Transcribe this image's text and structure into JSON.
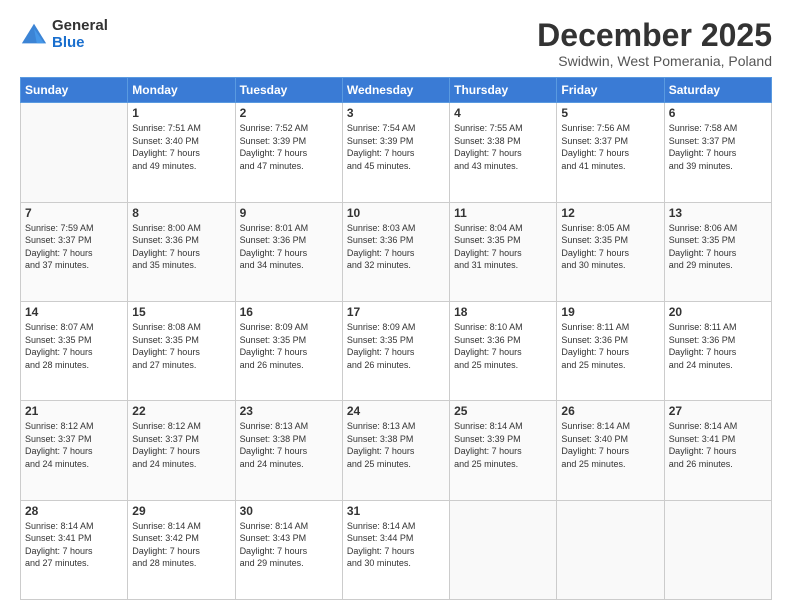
{
  "logo": {
    "general": "General",
    "blue": "Blue"
  },
  "title": "December 2025",
  "subtitle": "Swidwin, West Pomerania, Poland",
  "weekdays": [
    "Sunday",
    "Monday",
    "Tuesday",
    "Wednesday",
    "Thursday",
    "Friday",
    "Saturday"
  ],
  "weeks": [
    [
      {
        "day": "",
        "info": ""
      },
      {
        "day": "1",
        "info": "Sunrise: 7:51 AM\nSunset: 3:40 PM\nDaylight: 7 hours\nand 49 minutes."
      },
      {
        "day": "2",
        "info": "Sunrise: 7:52 AM\nSunset: 3:39 PM\nDaylight: 7 hours\nand 47 minutes."
      },
      {
        "day": "3",
        "info": "Sunrise: 7:54 AM\nSunset: 3:39 PM\nDaylight: 7 hours\nand 45 minutes."
      },
      {
        "day": "4",
        "info": "Sunrise: 7:55 AM\nSunset: 3:38 PM\nDaylight: 7 hours\nand 43 minutes."
      },
      {
        "day": "5",
        "info": "Sunrise: 7:56 AM\nSunset: 3:37 PM\nDaylight: 7 hours\nand 41 minutes."
      },
      {
        "day": "6",
        "info": "Sunrise: 7:58 AM\nSunset: 3:37 PM\nDaylight: 7 hours\nand 39 minutes."
      }
    ],
    [
      {
        "day": "7",
        "info": "Sunrise: 7:59 AM\nSunset: 3:37 PM\nDaylight: 7 hours\nand 37 minutes."
      },
      {
        "day": "8",
        "info": "Sunrise: 8:00 AM\nSunset: 3:36 PM\nDaylight: 7 hours\nand 35 minutes."
      },
      {
        "day": "9",
        "info": "Sunrise: 8:01 AM\nSunset: 3:36 PM\nDaylight: 7 hours\nand 34 minutes."
      },
      {
        "day": "10",
        "info": "Sunrise: 8:03 AM\nSunset: 3:36 PM\nDaylight: 7 hours\nand 32 minutes."
      },
      {
        "day": "11",
        "info": "Sunrise: 8:04 AM\nSunset: 3:35 PM\nDaylight: 7 hours\nand 31 minutes."
      },
      {
        "day": "12",
        "info": "Sunrise: 8:05 AM\nSunset: 3:35 PM\nDaylight: 7 hours\nand 30 minutes."
      },
      {
        "day": "13",
        "info": "Sunrise: 8:06 AM\nSunset: 3:35 PM\nDaylight: 7 hours\nand 29 minutes."
      }
    ],
    [
      {
        "day": "14",
        "info": "Sunrise: 8:07 AM\nSunset: 3:35 PM\nDaylight: 7 hours\nand 28 minutes."
      },
      {
        "day": "15",
        "info": "Sunrise: 8:08 AM\nSunset: 3:35 PM\nDaylight: 7 hours\nand 27 minutes."
      },
      {
        "day": "16",
        "info": "Sunrise: 8:09 AM\nSunset: 3:35 PM\nDaylight: 7 hours\nand 26 minutes."
      },
      {
        "day": "17",
        "info": "Sunrise: 8:09 AM\nSunset: 3:35 PM\nDaylight: 7 hours\nand 26 minutes."
      },
      {
        "day": "18",
        "info": "Sunrise: 8:10 AM\nSunset: 3:36 PM\nDaylight: 7 hours\nand 25 minutes."
      },
      {
        "day": "19",
        "info": "Sunrise: 8:11 AM\nSunset: 3:36 PM\nDaylight: 7 hours\nand 25 minutes."
      },
      {
        "day": "20",
        "info": "Sunrise: 8:11 AM\nSunset: 3:36 PM\nDaylight: 7 hours\nand 24 minutes."
      }
    ],
    [
      {
        "day": "21",
        "info": "Sunrise: 8:12 AM\nSunset: 3:37 PM\nDaylight: 7 hours\nand 24 minutes."
      },
      {
        "day": "22",
        "info": "Sunrise: 8:12 AM\nSunset: 3:37 PM\nDaylight: 7 hours\nand 24 minutes."
      },
      {
        "day": "23",
        "info": "Sunrise: 8:13 AM\nSunset: 3:38 PM\nDaylight: 7 hours\nand 24 minutes."
      },
      {
        "day": "24",
        "info": "Sunrise: 8:13 AM\nSunset: 3:38 PM\nDaylight: 7 hours\nand 25 minutes."
      },
      {
        "day": "25",
        "info": "Sunrise: 8:14 AM\nSunset: 3:39 PM\nDaylight: 7 hours\nand 25 minutes."
      },
      {
        "day": "26",
        "info": "Sunrise: 8:14 AM\nSunset: 3:40 PM\nDaylight: 7 hours\nand 25 minutes."
      },
      {
        "day": "27",
        "info": "Sunrise: 8:14 AM\nSunset: 3:41 PM\nDaylight: 7 hours\nand 26 minutes."
      }
    ],
    [
      {
        "day": "28",
        "info": "Sunrise: 8:14 AM\nSunset: 3:41 PM\nDaylight: 7 hours\nand 27 minutes."
      },
      {
        "day": "29",
        "info": "Sunrise: 8:14 AM\nSunset: 3:42 PM\nDaylight: 7 hours\nand 28 minutes."
      },
      {
        "day": "30",
        "info": "Sunrise: 8:14 AM\nSunset: 3:43 PM\nDaylight: 7 hours\nand 29 minutes."
      },
      {
        "day": "31",
        "info": "Sunrise: 8:14 AM\nSunset: 3:44 PM\nDaylight: 7 hours\nand 30 minutes."
      },
      {
        "day": "",
        "info": ""
      },
      {
        "day": "",
        "info": ""
      },
      {
        "day": "",
        "info": ""
      }
    ]
  ]
}
